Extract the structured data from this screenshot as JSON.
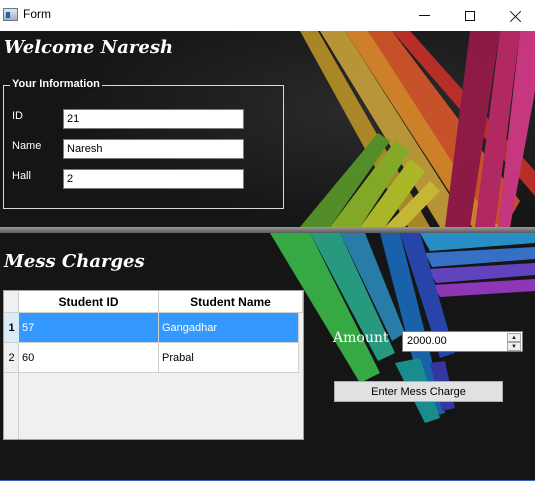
{
  "window": {
    "title": "Form",
    "icon": "app-window-icon"
  },
  "welcome": {
    "heading": "Welcome Naresh"
  },
  "info": {
    "legend": "Your Information",
    "fields": [
      {
        "label": "ID",
        "value": "21"
      },
      {
        "label": "Name",
        "value": "Naresh"
      },
      {
        "label": "Hall",
        "value": "2"
      }
    ]
  },
  "mess": {
    "heading": "Mess Charges",
    "table": {
      "columns": [
        "Student ID",
        "Student Name"
      ],
      "rows": [
        {
          "row_number": "1",
          "student_id": "57",
          "student_name": "Gangadhar",
          "selected": true
        },
        {
          "row_number": "2",
          "student_id": "60",
          "student_name": "Prabal",
          "selected": false
        }
      ]
    },
    "amount": {
      "label": "Amount",
      "value": "2000.00"
    },
    "enter_button": "Enter Mess Charge"
  },
  "colors": {
    "background": "#151515",
    "selection": "#3399ff",
    "text_light": "#ffffff"
  }
}
